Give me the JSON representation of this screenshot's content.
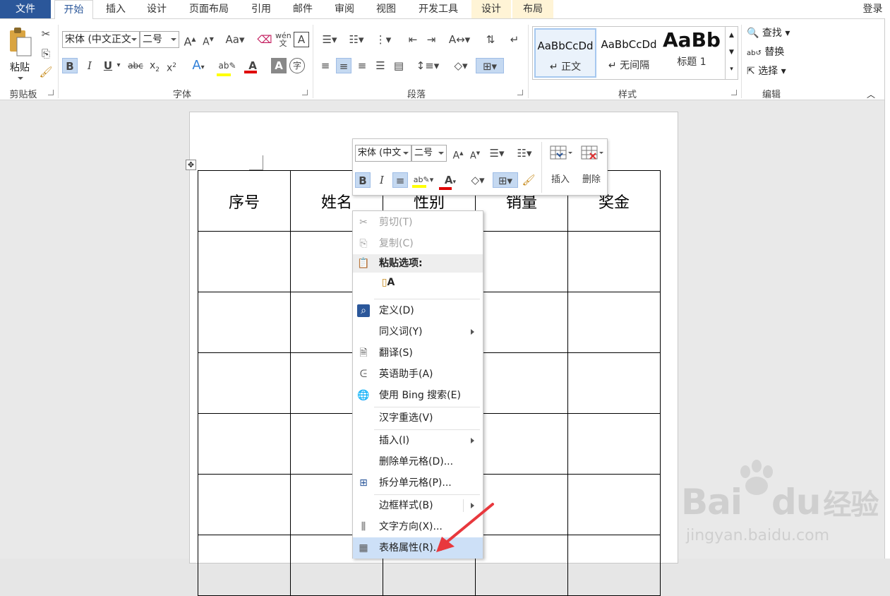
{
  "tabs": {
    "file": "文件",
    "home": "开始",
    "insert": "插入",
    "design": "设计",
    "layout": "页面布局",
    "references": "引用",
    "mailings": "邮件",
    "review": "审阅",
    "view": "视图",
    "developer": "开发工具",
    "table_design": "设计",
    "table_layout": "布局"
  },
  "login": "登录",
  "ribbon": {
    "clipboard": {
      "label": "剪贴板",
      "paste": "粘贴"
    },
    "font": {
      "label": "字体",
      "font_name": "宋体 (中文正文",
      "font_size": "二号",
      "aa": "Aa"
    },
    "paragraph": {
      "label": "段落"
    },
    "styles": {
      "label": "样式",
      "items": [
        {
          "sample": "AaBbCcDd",
          "name": "↵ 正文"
        },
        {
          "sample": "AaBbCcDd",
          "name": "↵ 无间隔"
        },
        {
          "sample": "AaBb",
          "name": "标题 1"
        }
      ]
    },
    "editing": {
      "label": "编辑",
      "find": "查找",
      "replace": "替换",
      "select": "选择"
    }
  },
  "table": {
    "headers": [
      "序号",
      "姓名",
      "性别",
      "销量",
      "奖金"
    ]
  },
  "mini_toolbar": {
    "font_name": "宋体 (中文",
    "font_size": "二号",
    "insert": "插入",
    "delete": "删除"
  },
  "context_menu": {
    "cut": "剪切(T)",
    "copy": "复制(C)",
    "paste_options": "粘贴选项:",
    "define": "定义(D)",
    "synonyms": "同义词(Y)",
    "translate": "翻译(S)",
    "english_assistant": "英语助手(A)",
    "bing_search": "使用 Bing 搜索(E)",
    "hanzi_reselect": "汉字重选(V)",
    "insert": "插入(I)",
    "delete_cells": "删除单元格(D)...",
    "split_cells": "拆分单元格(P)...",
    "border_styles": "边框样式(B)",
    "text_direction": "文字方向(X)...",
    "table_properties": "表格属性(R)..."
  },
  "watermark": {
    "brand": "Bai",
    "brand2": "du",
    "cn": "经验",
    "url": "jingyan.baidu.com"
  },
  "colors": {
    "accent": "#2b579a",
    "highlight": "#c5d9f1",
    "font_red": "#e00000",
    "highlight_yellow": "#ffff00",
    "arrow_red": "#e8383d"
  }
}
